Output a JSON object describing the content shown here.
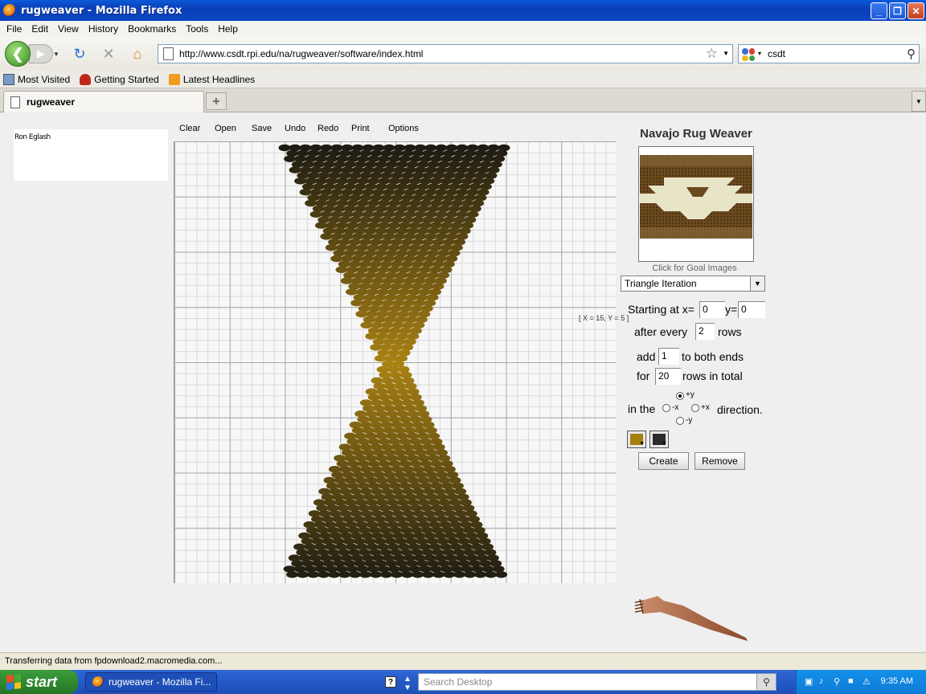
{
  "window": {
    "title": "rugweaver - Mozilla Firefox"
  },
  "menu": [
    "File",
    "Edit",
    "View",
    "History",
    "Bookmarks",
    "Tools",
    "Help"
  ],
  "address": {
    "url": "http://www.csdt.rpi.edu/na/rugweaver/software/index.html"
  },
  "search": {
    "value": "csdt"
  },
  "bookmarks": [
    "Most Visited",
    "Getting Started",
    "Latest Headlines"
  ],
  "tab": {
    "title": "rugweaver"
  },
  "app": {
    "author": "Ron Eglash",
    "toolbar": [
      "Clear",
      "Open",
      "Save",
      "Undo",
      "Redo",
      "Print",
      "Options"
    ],
    "coord_readout": "[ X = 15, Y = 5 ]",
    "title": "Navajo Rug Weaver",
    "goal_caption": "Click for Goal Images",
    "mode": "Triangle Iteration",
    "form": {
      "starting_at_x": "Starting at x=",
      "x_value": "0",
      "y_label": "y=",
      "y_value": "0",
      "after_every": "after every",
      "every_value": "2",
      "rows": "rows",
      "add": "add",
      "add_value": "1",
      "to_both_ends": "to both ends",
      "for": "for",
      "for_value": "20",
      "rows_in_total": "rows in total",
      "in_the": "in the",
      "direction": "direction.",
      "dir_plus_y": "+y",
      "dir_minus_x": "-x",
      "dir_plus_x": "+x",
      "dir_minus_y": "-y",
      "selected_direction": "+y"
    },
    "colors": {
      "primary": "#a5800f",
      "secondary": "#2a2a2a"
    },
    "buttons": {
      "create": "Create",
      "remove": "Remove"
    }
  },
  "status": "Transferring data from fpdownload2.macromedia.com...",
  "taskbar": {
    "start": "start",
    "task": "rugweaver - Mozilla Fi...",
    "search_placeholder": "Search Desktop",
    "clock": "9:35 AM"
  }
}
